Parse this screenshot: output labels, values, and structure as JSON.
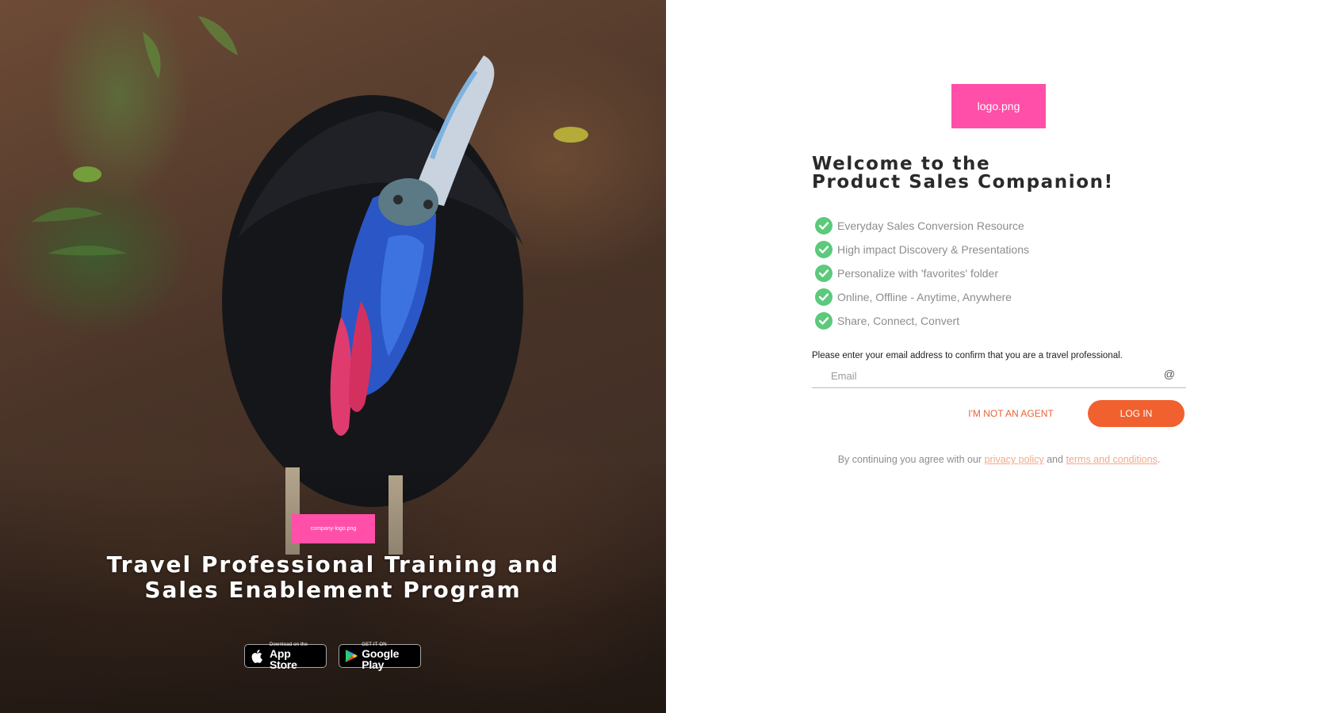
{
  "hero": {
    "company_logo_label": "company-logo.png",
    "title": "Travel Professional Training and Sales Enablement Program",
    "app_store": {
      "small": "Download on the",
      "big": "App Store"
    },
    "google_play": {
      "small": "GET IT ON",
      "big": "Google Play"
    }
  },
  "panel": {
    "logo_label": "logo.png",
    "welcome_line1": "Welcome to the",
    "welcome_line2": "Product Sales Companion!",
    "features": [
      "Everyday Sales Conversion Resource",
      "High impact Discovery & Presentations",
      "Personalize with 'favorites' folder",
      "Online, Offline - Anytime, Anywhere",
      "Share, Connect, Convert"
    ],
    "prompt": "Please enter your email address to confirm that you are a travel professional.",
    "email_placeholder": "Email",
    "email_value": "",
    "not_agent_label": "I'M NOT AN AGENT",
    "login_label": "LOG IN",
    "terms_prefix": "By continuing you agree with our",
    "privacy_label": "privacy policy",
    "terms_and": "and",
    "terms_label": "terms and conditions",
    "terms_suffix": "."
  },
  "colors": {
    "accent": "#f0612f",
    "check": "#5cc97b",
    "logo_placeholder": "#ff4fa8"
  },
  "icons": [
    "check-icon",
    "at-icon",
    "apple-icon",
    "google-play-icon"
  ]
}
